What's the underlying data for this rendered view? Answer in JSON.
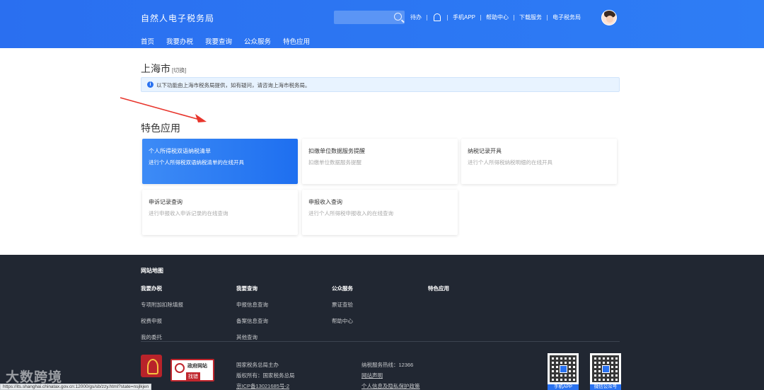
{
  "header": {
    "brand": "自然人电子税务局",
    "search_placeholder": "",
    "links": [
      "待办",
      "手机APP",
      "帮助中心",
      "下载服务",
      "电子税务局"
    ],
    "nav": [
      "首页",
      "我要办税",
      "我要查询",
      "公众服务",
      "特色应用"
    ],
    "active_nav": "特色应用",
    "colors": {
      "primary": "#2a72f0"
    }
  },
  "main": {
    "city": "上海市",
    "switch": "[切换]",
    "notice": "以下功能由上海市税务局提供，如有疑问，请咨询上海市税务局。",
    "section_title": "特色应用",
    "cards": [
      {
        "title": "个人所得税双语纳税清单",
        "desc": "进行个人所得税双语纳税清单的在线开具"
      },
      {
        "title": "扣缴单位数据服务提醒",
        "desc": "扣缴单位数据服务提醒"
      },
      {
        "title": "纳税记录开具",
        "desc": "进行个人所得税纳税明细的在线开具"
      },
      {
        "title": "申诉记录查询",
        "desc": "进行申报收入申诉记录的在线查询"
      },
      {
        "title": "申报收入查询",
        "desc": "进行个人所得税申报收入的在线查询"
      }
    ]
  },
  "footer": {
    "sitemap": "网站地图",
    "columns": [
      {
        "head": "我要办税",
        "links": [
          "专项附加扣除填报",
          "税费申报",
          "我的委托"
        ]
      },
      {
        "head": "我要查询",
        "links": [
          "申报信息查询",
          "备案信息查询",
          "其他查询"
        ]
      },
      {
        "head": "公众服务",
        "links": [
          "票证查验",
          "帮助中心"
        ]
      },
      {
        "head": "特色应用",
        "links": []
      }
    ],
    "gov_badge": {
      "line1": "政府网站",
      "line2": "找错"
    },
    "info_left": [
      "国家税务总局主办",
      "版权所有：国家税务总局",
      "京ICP备13021685号-2"
    ],
    "info_right": [
      "纳税服务热线：12366",
      "网站声明",
      "个人信息及隐私保护政策"
    ],
    "qr_labels": [
      "手机APP",
      "微信公众号"
    ]
  },
  "status_url": "https://its.shanghai.chinatax.gov.cn:12000/gs/sb/zzy.html?state=nsjlkjen",
  "watermark": "大数跨境"
}
